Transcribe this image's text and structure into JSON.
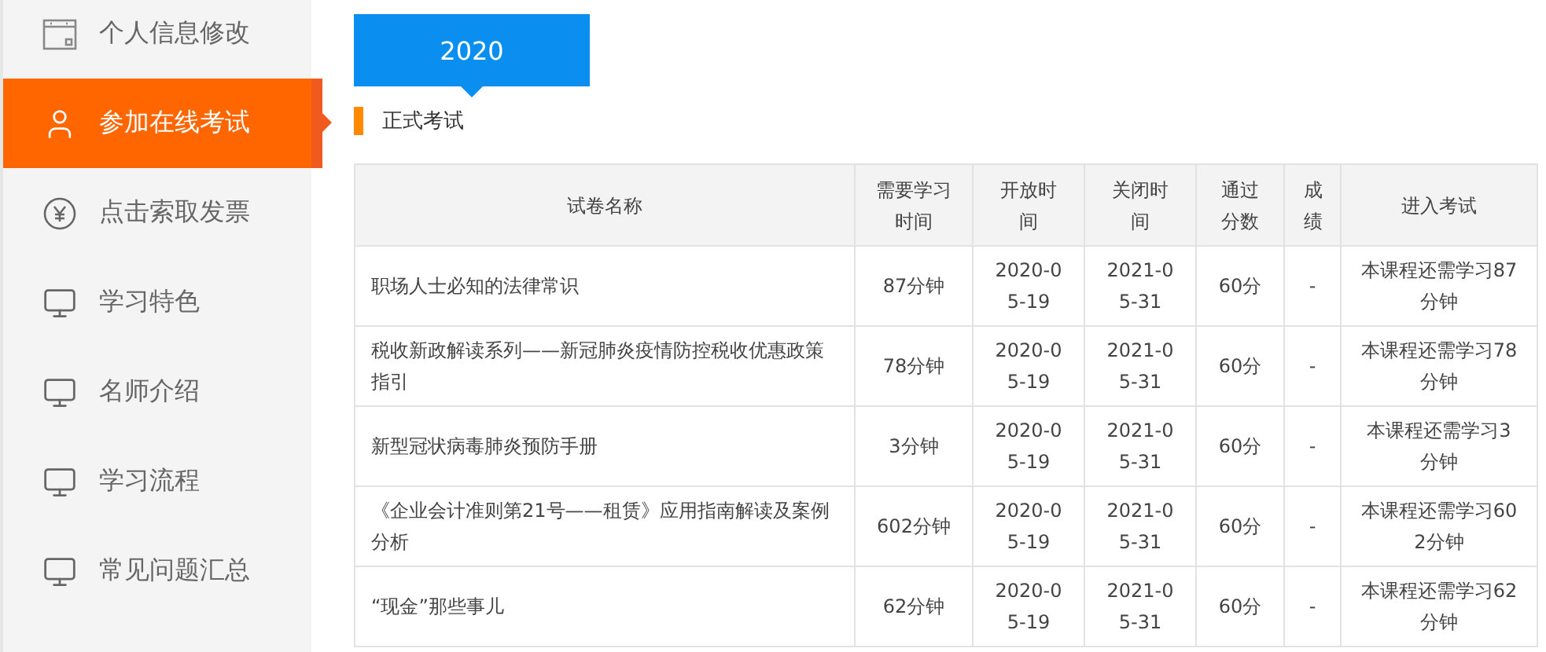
{
  "sidebar": {
    "items": [
      {
        "label": "个人信息修改",
        "kind": "window",
        "selected": false
      },
      {
        "label": "参加在线考试",
        "kind": "user",
        "selected": true
      },
      {
        "label": "点击索取发票",
        "kind": "yen",
        "selected": false
      },
      {
        "label": "学习特色",
        "kind": "monitor",
        "selected": false
      },
      {
        "label": "名师介绍",
        "kind": "monitor",
        "selected": false
      },
      {
        "label": "学习流程",
        "kind": "monitor",
        "selected": false
      },
      {
        "label": "常见问题汇总",
        "kind": "monitor",
        "selected": false
      }
    ]
  },
  "year_tabs": [
    {
      "label": "2020",
      "selected": true
    }
  ],
  "section_title": "正式考试",
  "table": {
    "columns": [
      "试卷名称",
      "需要学习时间",
      "开放时间",
      "关闭时间",
      "通过分数",
      "成绩",
      "进入考试"
    ],
    "rows": [
      [
        "职场人士必知的法律常识",
        "87分钟",
        "2020-05-19",
        "2021-05-31",
        "60分",
        "-",
        "本课程还需学习87分钟"
      ],
      [
        "税收新政解读系列——新冠肺炎疫情防控税收优惠政策指引",
        "78分钟",
        "2020-05-19",
        "2021-05-31",
        "60分",
        "-",
        "本课程还需学习78分钟"
      ],
      [
        "新型冠状病毒肺炎预防手册",
        "3分钟",
        "2020-05-19",
        "2021-05-31",
        "60分",
        "-",
        "本课程还需学习3分钟"
      ],
      [
        "《企业会计准则第21号——租赁》应用指南解读及案例分析",
        "602分钟",
        "2020-05-19",
        "2021-05-31",
        "60分",
        "-",
        "本课程还需学习602分钟"
      ],
      [
        "“现金”那些事儿",
        "62分钟",
        "2020-05-19",
        "2021-05-31",
        "60分",
        "-",
        "本课程还需学习62分钟"
      ]
    ]
  }
}
